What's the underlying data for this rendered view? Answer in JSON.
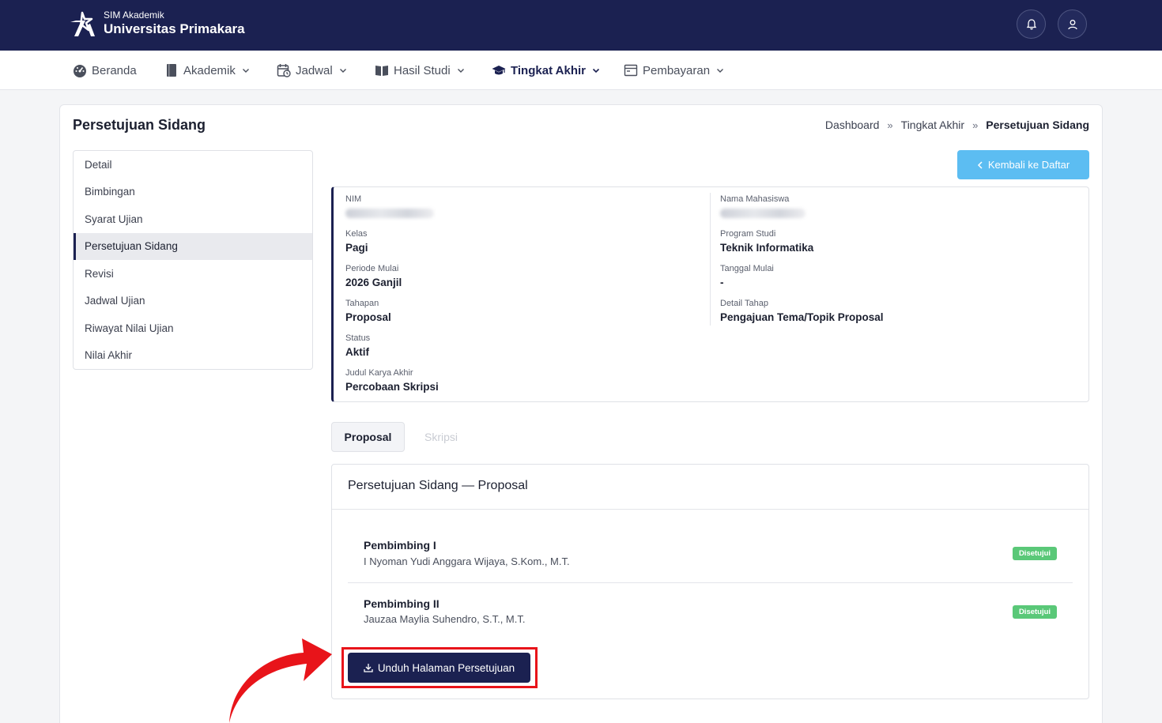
{
  "header": {
    "brand_small": "SIM Akademik",
    "brand_name": "Universitas Primakara",
    "icons": [
      "logo-icon",
      "bell-icon",
      "user-icon"
    ],
    "colors": {
      "primary": "#1b2151",
      "accent": "#5cbdf2",
      "success": "#5ac878",
      "highlight": "#e8141a"
    }
  },
  "nav": {
    "items": [
      {
        "label": "Beranda",
        "icon": "dashboard-icon"
      },
      {
        "label": "Akademik",
        "icon": "book-icon"
      },
      {
        "label": "Jadwal",
        "icon": "calendar-icon"
      },
      {
        "label": "Hasil Studi",
        "icon": "open-book-icon"
      },
      {
        "label": "Tingkat Akhir",
        "icon": "graduation-cap-icon"
      },
      {
        "label": "Pembayaran",
        "icon": "wallet-icon"
      }
    ]
  },
  "page": {
    "title": "Persetujuan Sidang",
    "breadcrumb": [
      "Dashboard",
      "Tingkat Akhir",
      "Persetujuan Sidang"
    ],
    "breadcrumb_sep": "»",
    "back_button": "Kembali ke Daftar"
  },
  "sidebar": {
    "items": [
      {
        "label": "Detail"
      },
      {
        "label": "Bimbingan"
      },
      {
        "label": "Syarat Ujian"
      },
      {
        "label": "Persetujuan Sidang"
      },
      {
        "label": "Revisi"
      },
      {
        "label": "Jadwal Ujian"
      },
      {
        "label": "Riwayat Nilai Ujian"
      },
      {
        "label": "Nilai Akhir"
      }
    ],
    "active": "Persetujuan Sidang"
  },
  "info": {
    "nim_label": "NIM",
    "nama_label": "Nama Mahasiswa",
    "kelas_label": "Kelas",
    "kelas": "Pagi",
    "prodi_label": "Program Studi",
    "prodi": "Teknik Informatika",
    "periode_label": "Periode Mulai",
    "periode": "2026 Ganjil",
    "tanggal_label": "Tanggal Mulai",
    "tanggal": "-",
    "tahapan_label": "Tahapan",
    "tahapan": "Proposal",
    "detail_label": "Detail Tahap",
    "detail": "Pengajuan Tema/Topik Proposal",
    "status_label": "Status",
    "status": "Aktif",
    "judul_label": "Judul Karya Akhir",
    "judul": "Percobaan Skripsi"
  },
  "tabs": [
    {
      "label": "Proposal"
    },
    {
      "label": "Skripsi"
    }
  ],
  "approval": {
    "title": "Persetujuan Sidang — Proposal",
    "advisors": [
      {
        "role": "Pembimbing I",
        "name": "I Nyoman Yudi Anggara Wijaya, S.Kom., M.T.",
        "status": "Disetujui"
      },
      {
        "role": "Pembimbing II",
        "name": "Jauzaa Maylia Suhendro, S.T., M.T.",
        "status": "Disetujui"
      }
    ],
    "download_button": "Unduh Halaman Persetujuan"
  }
}
